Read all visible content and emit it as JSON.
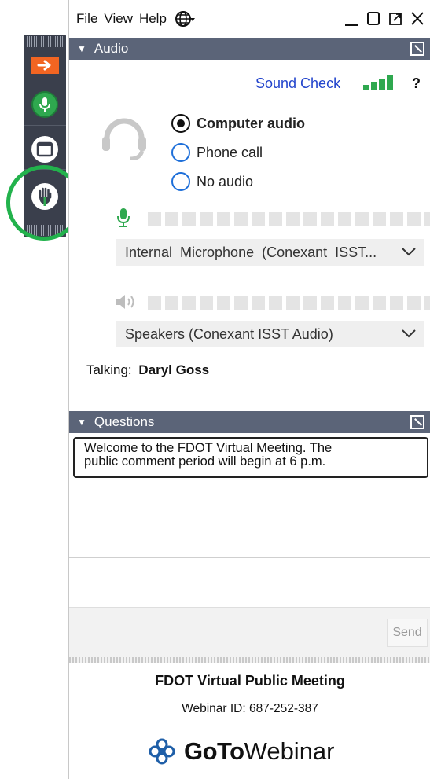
{
  "menu": {
    "items": [
      "File",
      "View",
      "Help"
    ]
  },
  "audio": {
    "section_title": "Audio",
    "sound_check": "Sound Check",
    "help": "?",
    "options": [
      "Computer audio",
      "Phone call",
      "No audio"
    ],
    "selected": "Computer audio",
    "microphone": "Internal  Microphone  (Conexant  ISST...",
    "speakers": "Speakers (Conexant ISST Audio)",
    "talking_label": "Talking:",
    "talking_name": "Daryl Goss"
  },
  "questions": {
    "section_title": "Questions",
    "message_line1": "Welcome to the FDOT Virtual Meeting. The",
    "message_line2": "public comment period will begin at 6 p.m.",
    "send_label": "Send"
  },
  "footer": {
    "title": "FDOT Virtual Public Meeting",
    "webinar_id": "Webinar ID: 687-252-387",
    "logo_bold": "GoTo",
    "logo_light": "Webinar"
  },
  "icons": {
    "strip_arrow": "arrow-right-icon",
    "strip_mic": "microphone-icon",
    "strip_screen": "screen-icon",
    "strip_hand": "raise-hand-icon",
    "globe": "globe-icon",
    "headset": "headset-icon"
  },
  "colors": {
    "accent_orange": "#f26522",
    "accent_green": "#2fa84f",
    "section_bar": "#5b6478",
    "link_blue": "#2244cc",
    "highlight_ring": "#22b24c"
  }
}
